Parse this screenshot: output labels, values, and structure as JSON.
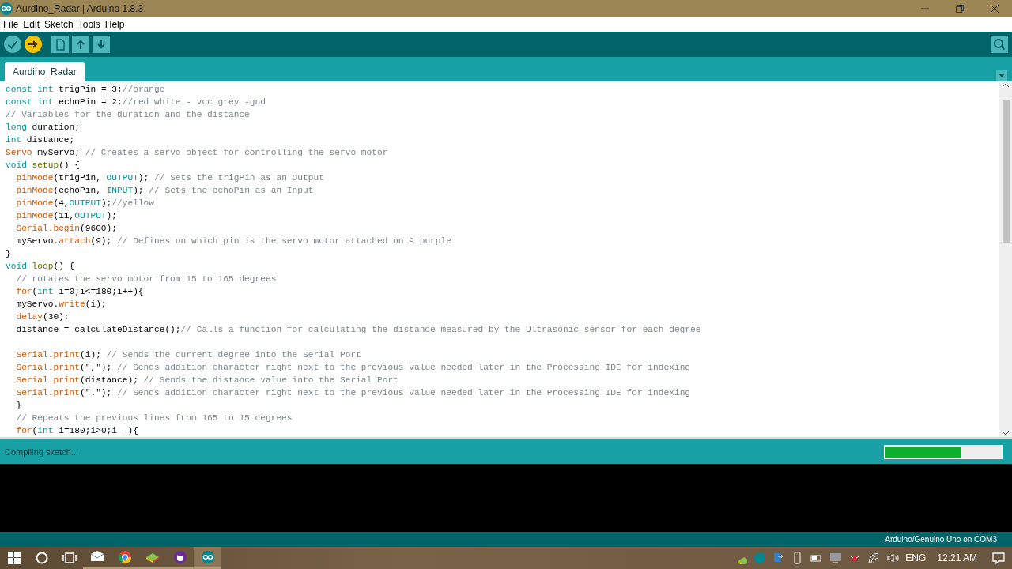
{
  "window": {
    "title": "Aurdino_Radar | Arduino 1.8.3"
  },
  "menu": [
    "File",
    "Edit",
    "Sketch",
    "Tools",
    "Help"
  ],
  "toolbar": [
    {
      "kind": "verify",
      "active": false
    },
    {
      "kind": "upload",
      "active": true
    },
    {
      "kind": "new",
      "active": false
    },
    {
      "kind": "open",
      "active": false
    },
    {
      "kind": "save",
      "active": false
    }
  ],
  "tabs": [
    {
      "label": "Aurdino_Radar",
      "selected": true
    }
  ],
  "editor": {
    "lines": [
      {
        "kind": "code",
        "indent": false,
        "tokens": [
          {
            "kind": "keyword",
            "text": "const "
          },
          {
            "kind": "keyword",
            "text": "int"
          },
          {
            "kind": "plain",
            "text": " trigPin = 3;"
          },
          {
            "kind": "comment",
            "text": "//orange"
          }
        ]
      },
      {
        "kind": "code",
        "indent": false,
        "tokens": [
          {
            "kind": "keyword",
            "text": "const "
          },
          {
            "kind": "keyword",
            "text": "int"
          },
          {
            "kind": "plain",
            "text": " echoPin = 2;"
          },
          {
            "kind": "comment",
            "text": "//red white - vcc grey -gnd"
          }
        ]
      },
      {
        "kind": "code",
        "indent": false,
        "tokens": [
          {
            "kind": "comment",
            "text": "// Variables for the duration and the distance"
          }
        ]
      },
      {
        "kind": "code",
        "indent": false,
        "tokens": [
          {
            "kind": "keyword",
            "text": "long"
          },
          {
            "kind": "plain",
            "text": " duration;"
          }
        ]
      },
      {
        "kind": "code",
        "indent": false,
        "tokens": [
          {
            "kind": "keyword",
            "text": "int"
          },
          {
            "kind": "plain",
            "text": " distance;"
          }
        ]
      },
      {
        "kind": "code",
        "indent": false,
        "tokens": [
          {
            "kind": "function",
            "text": "Servo"
          },
          {
            "kind": "plain",
            "text": " myServo; "
          },
          {
            "kind": "comment",
            "text": "// Creates a servo object for controlling the servo motor"
          }
        ]
      },
      {
        "kind": "code",
        "indent": false,
        "tokens": [
          {
            "kind": "keyword",
            "text": "void "
          },
          {
            "kind": "structure",
            "text": "setup"
          },
          {
            "kind": "plain",
            "text": "() {"
          }
        ]
      },
      {
        "kind": "code",
        "indent": true,
        "tokens": [
          {
            "kind": "function",
            "text": "pinMode"
          },
          {
            "kind": "plain",
            "text": "(trigPin, "
          },
          {
            "kind": "keyword",
            "text": "OUTPUT"
          },
          {
            "kind": "plain",
            "text": "); "
          },
          {
            "kind": "comment",
            "text": "// Sets the trigPin as an Output"
          }
        ]
      },
      {
        "kind": "code",
        "indent": true,
        "tokens": [
          {
            "kind": "function",
            "text": "pinMode"
          },
          {
            "kind": "plain",
            "text": "(echoPin, "
          },
          {
            "kind": "keyword",
            "text": "INPUT"
          },
          {
            "kind": "plain",
            "text": "); "
          },
          {
            "kind": "comment",
            "text": "// Sets the echoPin as an Input"
          }
        ]
      },
      {
        "kind": "code",
        "indent": true,
        "tokens": [
          {
            "kind": "function",
            "text": "pinMode"
          },
          {
            "kind": "plain",
            "text": "(4,"
          },
          {
            "kind": "keyword",
            "text": "OUTPUT"
          },
          {
            "kind": "plain",
            "text": ");"
          },
          {
            "kind": "comment",
            "text": "//yellow"
          }
        ]
      },
      {
        "kind": "code",
        "indent": true,
        "tokens": [
          {
            "kind": "function",
            "text": "pinMode"
          },
          {
            "kind": "plain",
            "text": "(11,"
          },
          {
            "kind": "keyword",
            "text": "OUTPUT"
          },
          {
            "kind": "plain",
            "text": ");"
          }
        ]
      },
      {
        "kind": "code",
        "indent": true,
        "tokens": [
          {
            "kind": "function",
            "text": "Serial.begin"
          },
          {
            "kind": "plain",
            "text": "(9600);"
          }
        ]
      },
      {
        "kind": "code",
        "indent": true,
        "tokens": [
          {
            "kind": "plain",
            "text": "myServo."
          },
          {
            "kind": "function",
            "text": "attach"
          },
          {
            "kind": "plain",
            "text": "(9); "
          },
          {
            "kind": "comment",
            "text": "// Defines on which pin is the servo motor attached on 9 purple"
          }
        ]
      },
      {
        "kind": "code",
        "indent": false,
        "tokens": [
          {
            "kind": "plain",
            "text": "}"
          }
        ]
      },
      {
        "kind": "code",
        "indent": false,
        "tokens": [
          {
            "kind": "keyword",
            "text": "void "
          },
          {
            "kind": "structure",
            "text": "loop"
          },
          {
            "kind": "plain",
            "text": "() {"
          }
        ]
      },
      {
        "kind": "code",
        "indent": true,
        "tokens": [
          {
            "kind": "comment",
            "text": "// rotates the servo motor from 15 to 165 degrees"
          }
        ]
      },
      {
        "kind": "code",
        "indent": true,
        "tokens": [
          {
            "kind": "function",
            "text": "for"
          },
          {
            "kind": "plain",
            "text": "("
          },
          {
            "kind": "keyword",
            "text": "int"
          },
          {
            "kind": "plain",
            "text": " i=0;i<=180;i++){"
          }
        ]
      },
      {
        "kind": "code",
        "indent": true,
        "tokens": [
          {
            "kind": "plain",
            "text": "myServo."
          },
          {
            "kind": "function",
            "text": "write"
          },
          {
            "kind": "plain",
            "text": "(i);"
          }
        ]
      },
      {
        "kind": "code",
        "indent": true,
        "tokens": [
          {
            "kind": "function",
            "text": "delay"
          },
          {
            "kind": "plain",
            "text": "(30);"
          }
        ]
      },
      {
        "kind": "code",
        "indent": true,
        "tokens": [
          {
            "kind": "plain",
            "text": "distance = calculateDistance();"
          },
          {
            "kind": "comment",
            "text": "// Calls a function for calculating the distance measured by the Ultrasonic sensor for each degree"
          }
        ]
      },
      {
        "kind": "blank"
      },
      {
        "kind": "code",
        "indent": true,
        "tokens": [
          {
            "kind": "function",
            "text": "Serial.print"
          },
          {
            "kind": "plain",
            "text": "(i); "
          },
          {
            "kind": "comment",
            "text": "// Sends the current degree into the Serial Port"
          }
        ]
      },
      {
        "kind": "code",
        "indent": true,
        "tokens": [
          {
            "kind": "function",
            "text": "Serial.print"
          },
          {
            "kind": "plain",
            "text": "(\",\"); "
          },
          {
            "kind": "comment",
            "text": "// Sends addition character right next to the previous value needed later in the Processing IDE for indexing"
          }
        ]
      },
      {
        "kind": "code",
        "indent": true,
        "tokens": [
          {
            "kind": "function",
            "text": "Serial.print"
          },
          {
            "kind": "plain",
            "text": "(distance); "
          },
          {
            "kind": "comment",
            "text": "// Sends the distance value into the Serial Port"
          }
        ]
      },
      {
        "kind": "code",
        "indent": true,
        "tokens": [
          {
            "kind": "function",
            "text": "Serial.print"
          },
          {
            "kind": "plain",
            "text": "(\".\"); "
          },
          {
            "kind": "comment",
            "text": "// Sends addition character right next to the previous value needed later in the Processing IDE for indexing"
          }
        ]
      },
      {
        "kind": "code",
        "indent": true,
        "tokens": [
          {
            "kind": "plain",
            "text": "}"
          }
        ]
      },
      {
        "kind": "code",
        "indent": true,
        "tokens": [
          {
            "kind": "comment",
            "text": "// Repeats the previous lines from 165 to 15 degrees"
          }
        ]
      },
      {
        "kind": "code",
        "indent": true,
        "tokens": [
          {
            "kind": "function",
            "text": "for"
          },
          {
            "kind": "plain",
            "text": "("
          },
          {
            "kind": "keyword",
            "text": "int"
          },
          {
            "kind": "plain",
            "text": " i=180;i>0;i--){"
          }
        ]
      }
    ]
  },
  "status": {
    "message": "Compiling sketch...",
    "progress": {
      "level": 0.66
    }
  },
  "board_status": "Arduino/Genuino Uno on COM3",
  "taskbar": {
    "apps": [
      {
        "kind": "mail",
        "active": false
      },
      {
        "kind": "browser",
        "active": false
      },
      {
        "kind": "game",
        "active": false
      },
      {
        "kind": "chat",
        "active": false
      },
      {
        "kind": "arduino",
        "active": true
      }
    ],
    "language": "ENG",
    "time": "12:21 AM"
  }
}
